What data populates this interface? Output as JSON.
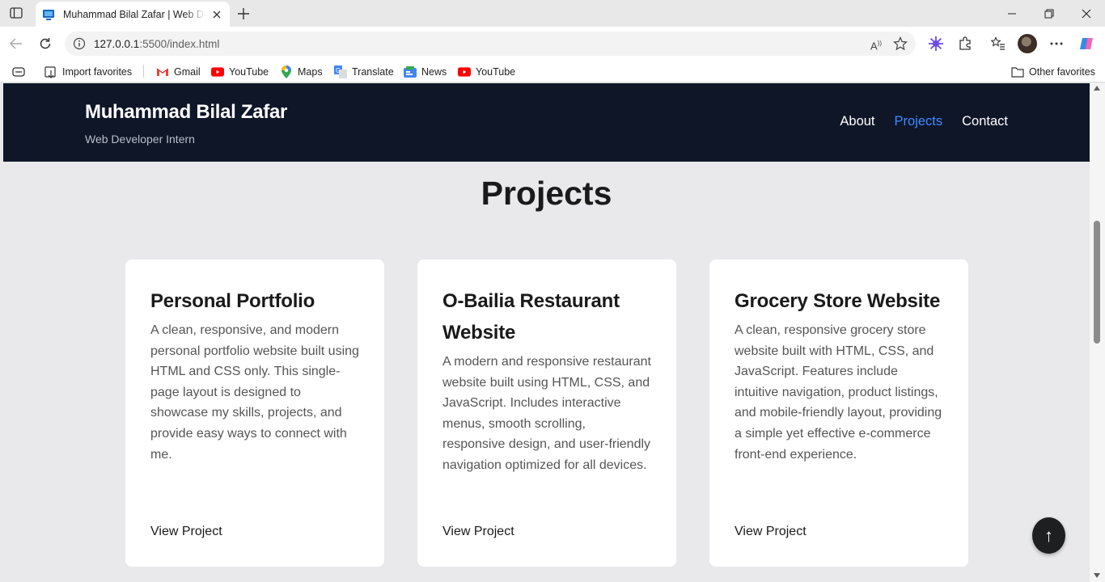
{
  "browser": {
    "tab_title": "Muhammad Bilal Zafar | Web Developer Intern",
    "url_host": "127.0.0.1",
    "url_rest": ":5500/index.html",
    "bookmarks": [
      {
        "label": "Import favorites",
        "icon": "import-icon"
      },
      {
        "label": "Gmail",
        "icon": "gmail-icon"
      },
      {
        "label": "YouTube",
        "icon": "youtube-icon"
      },
      {
        "label": "Maps",
        "icon": "maps-icon"
      },
      {
        "label": "Translate",
        "icon": "translate-icon"
      },
      {
        "label": "News",
        "icon": "news-icon"
      },
      {
        "label": "YouTube",
        "icon": "youtube-icon"
      }
    ],
    "other_favorites": "Other favorites"
  },
  "site": {
    "name": "Muhammad Bilal Zafar",
    "tagline": "Web Developer Intern",
    "nav": [
      {
        "label": "About",
        "active": false
      },
      {
        "label": "Projects",
        "active": true
      },
      {
        "label": "Contact",
        "active": false
      }
    ]
  },
  "projects": {
    "title": "Projects",
    "cards": [
      {
        "title": "Personal Portfolio",
        "description": "A clean, responsive, and modern personal portfolio website built using HTML and CSS only. This single-page layout is designed to showcase my skills, projects, and provide easy ways to connect with me.",
        "link": "View Project"
      },
      {
        "title": "O-Bailia Restaurant Website",
        "description": "A modern and responsive restaurant website built using HTML, CSS, and JavaScript. Includes interactive menus, smooth scrolling, responsive design, and user-friendly navigation optimized for all devices.",
        "link": "View Project"
      },
      {
        "title": "Grocery Store Website",
        "description": "A clean, responsive grocery store website built with HTML, CSS, and JavaScript. Features include intuitive navigation, product listings, and mobile-friendly layout, providing a simple yet effective e-commerce front-end experience.",
        "link": "View Project"
      }
    ]
  },
  "back_to_top": "↑",
  "colors": {
    "header_bg": "#0e1628",
    "nav_active": "#3f8cff",
    "page_bg": "#e9e9ec"
  }
}
